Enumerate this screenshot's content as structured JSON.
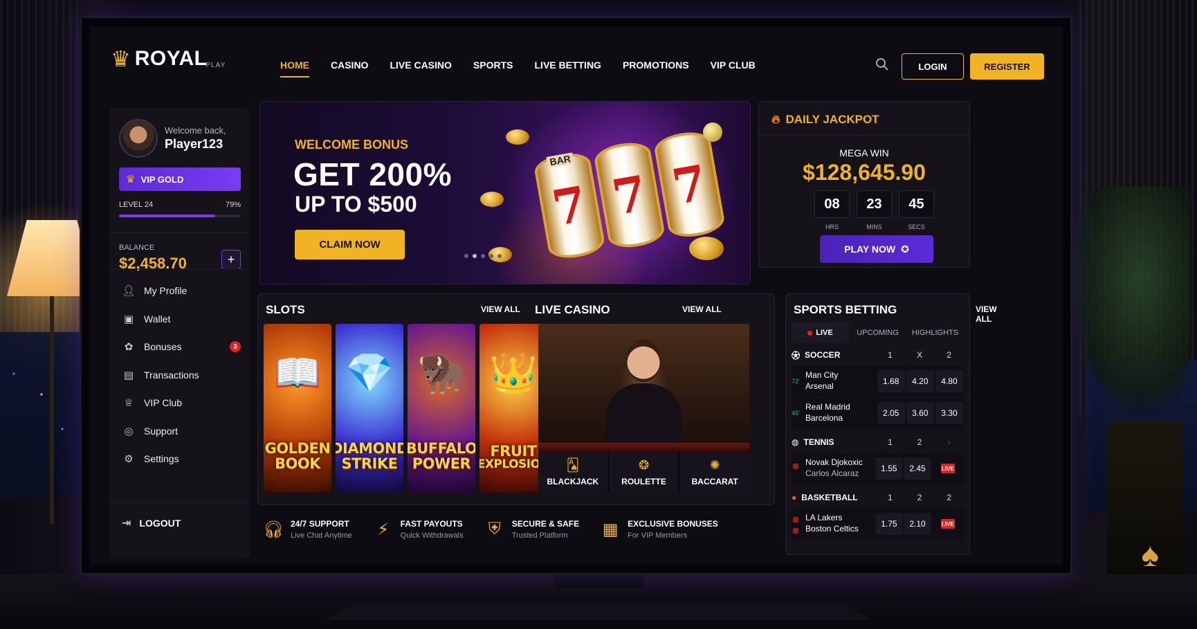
{
  "brand": {
    "name": "ROYAL",
    "sub": "PLAY"
  },
  "nav": [
    {
      "label": "HOME",
      "active": true
    },
    {
      "label": "CASINO"
    },
    {
      "label": "LIVE CASINO"
    },
    {
      "label": "SPORTS"
    },
    {
      "label": "LIVE BETTING"
    },
    {
      "label": "PROMOTIONS"
    },
    {
      "label": "VIP CLUB"
    }
  ],
  "auth": {
    "login": "LOGIN",
    "register": "REGISTER"
  },
  "user": {
    "greeting": "Welcome back,",
    "name": "Player123",
    "vip": "VIP GOLD",
    "level": "LEVEL 24",
    "progress_label": "79%",
    "progress": 0.79,
    "balance_label": "BALANCE",
    "balance": "$2,458.70"
  },
  "menu": [
    {
      "label": "My Profile",
      "icon": "user-icon"
    },
    {
      "label": "Wallet",
      "icon": "wallet-icon"
    },
    {
      "label": "Bonuses",
      "icon": "gift-icon",
      "badge": "3"
    },
    {
      "label": "Transactions",
      "icon": "receipt-icon"
    },
    {
      "label": "VIP Club",
      "icon": "crown-icon"
    },
    {
      "label": "Support",
      "icon": "support-icon"
    },
    {
      "label": "Settings",
      "icon": "gear-icon"
    }
  ],
  "logout": "LOGOUT",
  "hero": {
    "kicker": "WELCOME BONUS",
    "headline": "GET 200%",
    "subline": "UP TO $500",
    "cta": "CLAIM NOW",
    "reel_symbol": "7",
    "reel_label": "BAR"
  },
  "jackpot": {
    "title": "DAILY JACKPOT",
    "label": "MEGA WIN",
    "amount": "$128,645.90",
    "timer": [
      {
        "value": "08",
        "unit": "HRS"
      },
      {
        "value": "23",
        "unit": "MINS"
      },
      {
        "value": "45",
        "unit": "SECS"
      }
    ],
    "cta": "PLAY NOW"
  },
  "slots": {
    "title": "SLOTS",
    "view_all": "VIEW ALL",
    "games": [
      {
        "line1": "GOLDEN",
        "line2": "BOOK",
        "art": "📖"
      },
      {
        "line1": "DIAMOND",
        "line2": "STRIKE",
        "art": "💎"
      },
      {
        "line1": "BUFFALO",
        "line2": "POWER",
        "art": "🦬"
      },
      {
        "line1": "FRUIT",
        "line2": "EXPLOSION",
        "art": "👑"
      }
    ]
  },
  "live_casino": {
    "title": "LIVE CASINO",
    "view_all": "VIEW ALL",
    "games": [
      {
        "label": "BLACKJACK",
        "icon": "cards-icon"
      },
      {
        "label": "ROULETTE",
        "icon": "roulette-icon"
      },
      {
        "label": "BACCARAT",
        "icon": "chips-icon"
      }
    ]
  },
  "features": [
    {
      "title": "24/7 SUPPORT",
      "sub": "Live Chat Anytime",
      "icon": "headset-icon"
    },
    {
      "title": "FAST PAYOUTS",
      "sub": "Quick Withdrawals",
      "icon": "lightning-icon"
    },
    {
      "title": "SECURE & SAFE",
      "sub": "Trusted Platform",
      "icon": "shield-icon"
    },
    {
      "title": "EXCLUSIVE BONUSES",
      "sub": "For VIP Members",
      "icon": "gift-icon"
    }
  ],
  "sports": {
    "title": "SPORTS BETTING",
    "view_all": "VIEW ALL",
    "tabs": [
      "LIVE",
      "UPCOMING",
      "HIGHLIGHTS"
    ],
    "soccer": {
      "name": "SOCCER",
      "cols": [
        "1",
        "X",
        "2"
      ],
      "matches": [
        {
          "minute": "72'",
          "home": "Man City",
          "away": "Arsenal",
          "odds": [
            "1.68",
            "4.20",
            "4.80"
          ]
        },
        {
          "minute": "45'",
          "home": "Real Madrid",
          "away": "Barcelona",
          "odds": [
            "2.05",
            "3.60",
            "3.30"
          ]
        }
      ]
    },
    "tennis": {
      "name": "TENNIS",
      "cols": [
        "1",
        "2"
      ],
      "match": {
        "home": "Novak Djokoxic",
        "away": "Carlos Alcaraz",
        "odds": [
          "1.55",
          "2.45"
        ],
        "badge": "LIVE"
      }
    },
    "basketball": {
      "name": "BASKETBALL",
      "cols": [
        "1",
        "2",
        "2"
      ],
      "match": {
        "home": "LA Lakers",
        "away": "Boston Celtics",
        "odds": [
          "1.75",
          "2.10"
        ],
        "badge": "LIVE"
      }
    }
  }
}
